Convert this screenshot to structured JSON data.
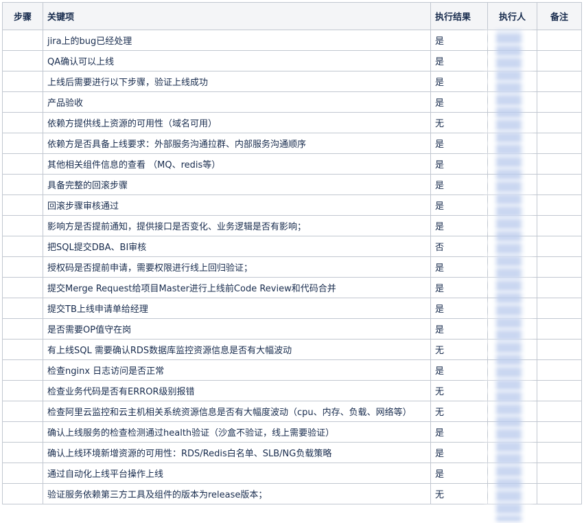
{
  "headers": {
    "step": "步骤",
    "item": "关键项",
    "result": "执行结果",
    "executor": "执行人",
    "note": "备注"
  },
  "rows": [
    {
      "step": "",
      "item": "jira上的bug已经处理",
      "result": "是",
      "executor": "",
      "note": ""
    },
    {
      "step": "",
      "item": "QA确认可以上线",
      "result": "是",
      "executor": "",
      "note": ""
    },
    {
      "step": "",
      "item": "上线后需要进行以下步骤，验证上线成功",
      "result": "是",
      "executor": "",
      "note": ""
    },
    {
      "step": "",
      "item": "产品验收",
      "result": "是",
      "executor": "",
      "note": ""
    },
    {
      "step": "",
      "item": "依赖方提供线上资源的可用性（域名可用）",
      "result": "无",
      "executor": "",
      "note": ""
    },
    {
      "step": "",
      "item": "依赖方是否具备上线要求：外部服务沟通拉群、内部服务沟通顺序",
      "result": "是",
      "executor": "",
      "note": ""
    },
    {
      "step": "",
      "item": "其他相关组件信息的查看 （MQ、redis等）",
      "result": "是",
      "executor": "",
      "note": ""
    },
    {
      "step": "",
      "item": "具备完整的回滚步骤",
      "result": "是",
      "executor": "",
      "note": ""
    },
    {
      "step": "",
      "item": "回滚步骤审核通过",
      "result": "是",
      "executor": "",
      "note": ""
    },
    {
      "step": "",
      "item": "影响方是否提前通知，提供接口是否变化、业务逻辑是否有影响；",
      "result": "是",
      "executor": "",
      "note": ""
    },
    {
      "step": "",
      "item": "把SQL提交DBA、BI审核",
      "result": "否",
      "executor": "",
      "note": ""
    },
    {
      "step": "",
      "item": "授权码是否提前申请，需要权限进行线上回归验证；",
      "result": "是",
      "executor": "",
      "note": ""
    },
    {
      "step": "",
      "item": "提交Merge Request给项目Master进行上线前Code Review和代码合并",
      "result": "是",
      "executor": "",
      "note": ""
    },
    {
      "step": "",
      "item": "提交TB上线申请单给经理",
      "result": "是",
      "executor": "",
      "note": ""
    },
    {
      "step": "",
      "item": "是否需要OP值守在岗",
      "result": "是",
      "executor": "",
      "note": ""
    },
    {
      "step": "",
      "item": "有上线SQL 需要确认RDS数据库监控资源信息是否有大幅波动",
      "result": "无",
      "executor": "",
      "note": ""
    },
    {
      "step": "",
      "item": "检查nginx 日志访问是否正常",
      "result": "是",
      "executor": "",
      "note": ""
    },
    {
      "step": "",
      "item": "检查业务代码是否有ERROR级别报错",
      "result": "无",
      "executor": "",
      "note": ""
    },
    {
      "step": "",
      "item": "检查阿里云监控和云主机相关系统资源信息是否有大幅度波动（cpu、内存、负载、网络等）",
      "result": "无",
      "executor": "",
      "note": ""
    },
    {
      "step": "",
      "item": "确认上线服务的检查检测通过health验证（沙盒不验证，线上需要验证）",
      "result": "是",
      "executor": "",
      "note": ""
    },
    {
      "step": "",
      "item": "确认上线环境新增资源的可用性：RDS/Redis白名单、SLB/NG负载策略",
      "result": "是",
      "executor": "",
      "note": ""
    },
    {
      "step": "",
      "item": "通过自动化上线平台操作上线",
      "result": "是",
      "executor": "",
      "note": ""
    },
    {
      "step": "",
      "item": "验证服务依赖第三方工具及组件的版本为release版本；",
      "result": "无",
      "executor": "",
      "note": ""
    }
  ]
}
